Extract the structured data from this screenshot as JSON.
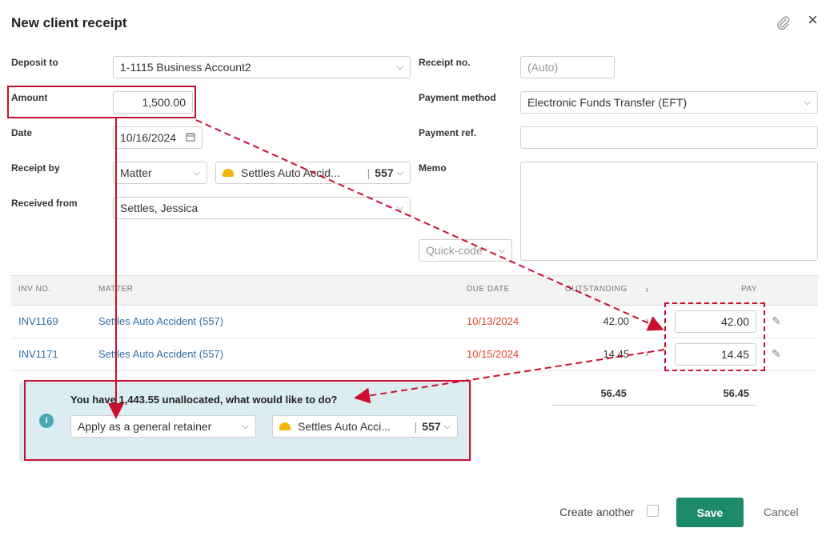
{
  "dialog": {
    "title": "New client receipt",
    "close_icon": "×",
    "attach_icon": "📎"
  },
  "form": {
    "deposit_to": {
      "label": "Deposit to",
      "value": "1-1115 Business Account2"
    },
    "amount": {
      "label": "Amount",
      "value": "1,500.00"
    },
    "date": {
      "label": "Date",
      "value": "10/16/2024"
    },
    "receipt_by": {
      "label": "Receipt by",
      "value": "Matter",
      "matter_name": "Settles Auto Accid...",
      "matter_number": "557"
    },
    "received_from": {
      "label": "Received from",
      "value": "Settles, Jessica"
    },
    "receipt_no": {
      "label": "Receipt no.",
      "placeholder": "(Auto)"
    },
    "payment_method": {
      "label": "Payment method",
      "value": "Electronic Funds Transfer (EFT)"
    },
    "payment_ref": {
      "label": "Payment ref.",
      "value": ""
    },
    "memo": {
      "label": "Memo",
      "value": ""
    },
    "quick_code": {
      "placeholder": "Quick-code"
    }
  },
  "table": {
    "headers": {
      "inv_no": "INV NO.",
      "matter": "MATTER",
      "due_date": "DUE DATE",
      "outstanding": "OUTSTANDING",
      "pay": "PAY"
    },
    "rows": [
      {
        "inv_no": "INV1169",
        "matter": "Settles Auto Accident (557)",
        "due_date": "10/13/2024",
        "outstanding": "42.00",
        "pay": "42.00"
      },
      {
        "inv_no": "INV1171",
        "matter": "Settles Auto Accident (557)",
        "due_date": "10/15/2024",
        "outstanding": "14.45",
        "pay": "14.45"
      }
    ],
    "totals": {
      "outstanding": "56.45",
      "pay": "56.45"
    }
  },
  "unallocated": {
    "message": "You have 1,443.55 unallocated, what would like to do?",
    "action": "Apply as a general retainer",
    "matter_name": "Settles Auto Acci...",
    "matter_number": "557",
    "info_icon": "i"
  },
  "footer": {
    "create_another": "Create another",
    "save": "Save",
    "cancel": "Cancel"
  },
  "colors": {
    "accent": "#1d8a6b",
    "link": "#2f6fa5",
    "overdue": "#e0452b",
    "annotation": "#c8102e",
    "info_bg": "#dcedf1"
  }
}
